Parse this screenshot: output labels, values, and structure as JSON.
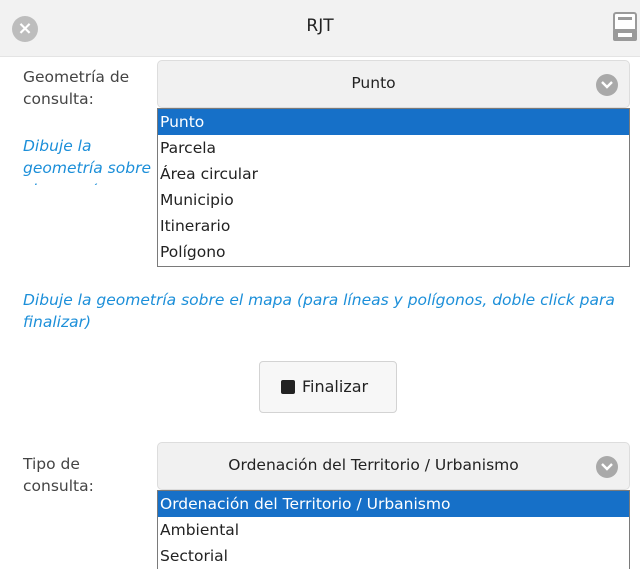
{
  "window": {
    "title": "RJT"
  },
  "geometry": {
    "label": "Geometría de consulta:",
    "selected": "Punto",
    "options": [
      "Punto",
      "Parcela",
      "Área circular",
      "Municipio",
      "Itinerario",
      "Polígono"
    ],
    "hint_partial": "Dibuje la geometría sobre el mapa (para finalizar)",
    "hint": "Dibuje la geometría sobre el mapa (para líneas y polígonos, doble click para finalizar)"
  },
  "finalizar": {
    "label": "Finalizar"
  },
  "query_type": {
    "label": "Tipo de consulta:",
    "selected": "Ordenación del Territorio / Urbanismo",
    "options": [
      "Ordenación del Territorio / Urbanismo",
      "Ambiental",
      "Sectorial"
    ]
  },
  "colors": {
    "accent": "#1670c8",
    "hint": "#1c8fd9"
  },
  "icons": {
    "close": "close-icon",
    "print": "print-icon",
    "chevron": "chevron-down-icon",
    "stop": "stop-icon"
  }
}
